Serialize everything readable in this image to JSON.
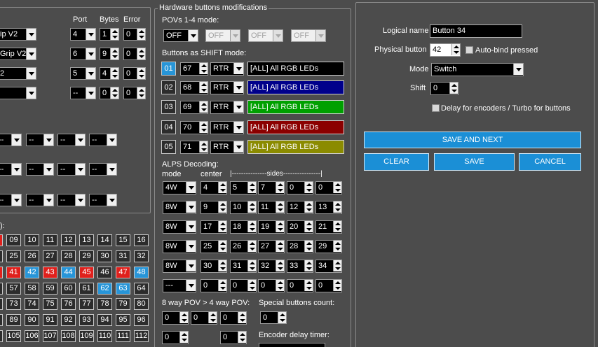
{
  "left_panel": {
    "headers": {
      "port": "Port",
      "bytes": "Bytes",
      "error": "Error"
    },
    "rows": [
      {
        "name": "ip V2",
        "port": "4",
        "bytes": "1",
        "error": "0"
      },
      {
        "name": "Grip V2",
        "port": "6",
        "bytes": "9",
        "error": "0"
      },
      {
        "name": "2",
        "port": "5",
        "bytes": "4",
        "error": "0"
      },
      {
        "name": "",
        "port": "--",
        "bytes": "0",
        "error": "0"
      }
    ],
    "dash_combos": [
      "--",
      "--",
      "--",
      "--",
      "--",
      "--",
      "--",
      "--",
      "--",
      "--",
      "--",
      "--"
    ],
    "grid_label": "):",
    "grid": [
      [
        {
          "t": "",
          "c": "red"
        },
        {
          "t": "09"
        },
        {
          "t": "10"
        },
        {
          "t": "11"
        },
        {
          "t": "12"
        },
        {
          "t": "13"
        },
        {
          "t": "14"
        },
        {
          "t": "15"
        },
        {
          "t": "16"
        }
      ],
      [
        {
          "t": ""
        },
        {
          "t": "25"
        },
        {
          "t": "26"
        },
        {
          "t": "27"
        },
        {
          "t": "28"
        },
        {
          "t": "29"
        },
        {
          "t": "30"
        },
        {
          "t": "31"
        },
        {
          "t": "32"
        }
      ],
      [
        {
          "t": "",
          "c": "red"
        },
        {
          "t": "41",
          "c": "red"
        },
        {
          "t": "42",
          "c": "blue"
        },
        {
          "t": "43",
          "c": "red"
        },
        {
          "t": "44",
          "c": "blue"
        },
        {
          "t": "45",
          "c": "red"
        },
        {
          "t": "46"
        },
        {
          "t": "47",
          "c": "red"
        },
        {
          "t": "48",
          "c": "blue"
        }
      ],
      [
        {
          "t": ""
        },
        {
          "t": "57"
        },
        {
          "t": "58"
        },
        {
          "t": "59"
        },
        {
          "t": "60"
        },
        {
          "t": "61"
        },
        {
          "t": "62",
          "c": "blue"
        },
        {
          "t": "63",
          "c": "blue"
        },
        {
          "t": "64"
        }
      ],
      [
        {
          "t": ""
        },
        {
          "t": "73"
        },
        {
          "t": "74"
        },
        {
          "t": "75"
        },
        {
          "t": "76"
        },
        {
          "t": "77"
        },
        {
          "t": "78"
        },
        {
          "t": "79"
        },
        {
          "t": "80"
        }
      ],
      [
        {
          "t": ""
        },
        {
          "t": "89"
        },
        {
          "t": "90"
        },
        {
          "t": "91"
        },
        {
          "t": "92"
        },
        {
          "t": "93"
        },
        {
          "t": "94"
        },
        {
          "t": "95"
        },
        {
          "t": "96"
        }
      ],
      [
        {
          "t": ""
        },
        {
          "t": "105"
        },
        {
          "t": "106"
        },
        {
          "t": "107"
        },
        {
          "t": "108"
        },
        {
          "t": "109"
        },
        {
          "t": "110"
        },
        {
          "t": "111"
        },
        {
          "t": "112"
        }
      ]
    ]
  },
  "hw_panel": {
    "title": "Hardware buttons modifications",
    "povs_label": "POVs 1-4 mode:",
    "povs": [
      {
        "value": "OFF",
        "disabled": false
      },
      {
        "value": "OFF",
        "disabled": true
      },
      {
        "value": "OFF",
        "disabled": true
      },
      {
        "value": "OFF",
        "disabled": true
      }
    ],
    "shift_label": "Buttons as SHIFT mode:",
    "shift_rows": [
      {
        "no": "01",
        "selected": true,
        "button": "67",
        "mode": "RTR",
        "led": "[ALL] All RGB LEDs",
        "led_color": "#000000",
        "led_text": "#ffffff"
      },
      {
        "no": "02",
        "selected": false,
        "button": "68",
        "mode": "RTR",
        "led": "[ALL] All RGB LEDs",
        "led_color": "#00008b",
        "led_text": "#ffffff"
      },
      {
        "no": "03",
        "selected": false,
        "button": "69",
        "mode": "RTR",
        "led": "[ALL] All RGB LEDs",
        "led_color": "#00a000",
        "led_text": "#ffffff"
      },
      {
        "no": "04",
        "selected": false,
        "button": "70",
        "mode": "RTR",
        "led": "[ALL] All RGB LEDs",
        "led_color": "#8b0000",
        "led_text": "#ffffff"
      },
      {
        "no": "05",
        "selected": false,
        "button": "71",
        "mode": "RTR",
        "led": "[ALL] All RGB LEDs",
        "led_color": "#8b8b00",
        "led_text": "#ffffff"
      }
    ],
    "alps_label": "ALPS Decoding:",
    "alps_mode_header": "mode",
    "alps_center_header": "center",
    "alps_sides_header": "|---------------sides----------------|",
    "alps_rows": [
      {
        "mode": "4W",
        "values": [
          "4",
          "5",
          "7",
          "0",
          "0"
        ]
      },
      {
        "mode": "8W",
        "values": [
          "9",
          "10",
          "11",
          "12",
          "13"
        ]
      },
      {
        "mode": "8W",
        "values": [
          "17",
          "18",
          "19",
          "20",
          "21"
        ]
      },
      {
        "mode": "8W",
        "values": [
          "25",
          "26",
          "27",
          "28",
          "29"
        ]
      },
      {
        "mode": "8W",
        "values": [
          "30",
          "31",
          "32",
          "33",
          "34"
        ]
      },
      {
        "mode": "---",
        "values": [
          "0",
          "0",
          "0",
          "0",
          "0"
        ]
      }
    ],
    "pov8_label": "8 way POV > 4 way POV:",
    "pov8_values": [
      "0",
      "0",
      "0"
    ],
    "pov8_values_row2": [
      "0",
      "0"
    ],
    "special_label": "Special buttons count:",
    "special_value": "0",
    "encoder_label": "Encoder delay timer:"
  },
  "right_panel": {
    "logical_name_label": "Logical name",
    "logical_name_value": "Button 34",
    "physical_button_label": "Physical button",
    "physical_button_value": "42",
    "auto_bind_label": "Auto-bind pressed",
    "mode_label": "Mode",
    "mode_value": "Switch",
    "shift_label": "Shift",
    "shift_value": "0",
    "delay_label": "Delay for encoders / Turbo for buttons",
    "save_next_label": "SAVE AND NEXT",
    "clear_label": "CLEAR",
    "save_label": "SAVE",
    "cancel_label": "CANCEL"
  }
}
